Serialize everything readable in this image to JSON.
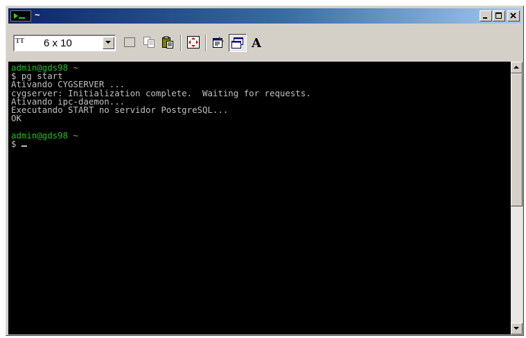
{
  "window": {
    "title": "~",
    "title_gradient": [
      "#0a246a",
      "#a6caf0"
    ]
  },
  "toolbar": {
    "font_type_label": "T",
    "font_size": "6 x 10",
    "tools": [
      {
        "name": "mark-icon"
      },
      {
        "name": "copy-icon"
      },
      {
        "name": "paste-icon"
      },
      {
        "name": "fullscreen-icon"
      },
      {
        "name": "properties-icon"
      },
      {
        "name": "background-icon"
      },
      {
        "name": "font-icon",
        "label": "A"
      }
    ]
  },
  "console": {
    "fg_color": "#c0c0c0",
    "prompt_color": "#1fbf1f",
    "path_color": "#b5a526",
    "lines": [
      {
        "user_host": "admin@gds98",
        "path": "~"
      },
      {
        "text": "$ pg start"
      },
      {
        "text": "Ativando CYGSERVER ..."
      },
      {
        "text": "cygserver: Initialization complete.  Waiting for requests."
      },
      {
        "text": "Ativando ipc-daemon..."
      },
      {
        "text": "Executando START no servidor PostgreSQL..."
      },
      {
        "text": "OK"
      },
      {
        "text": ""
      },
      {
        "user_host": "admin@gds98",
        "path": "~"
      },
      {
        "text": "$ "
      }
    ]
  }
}
